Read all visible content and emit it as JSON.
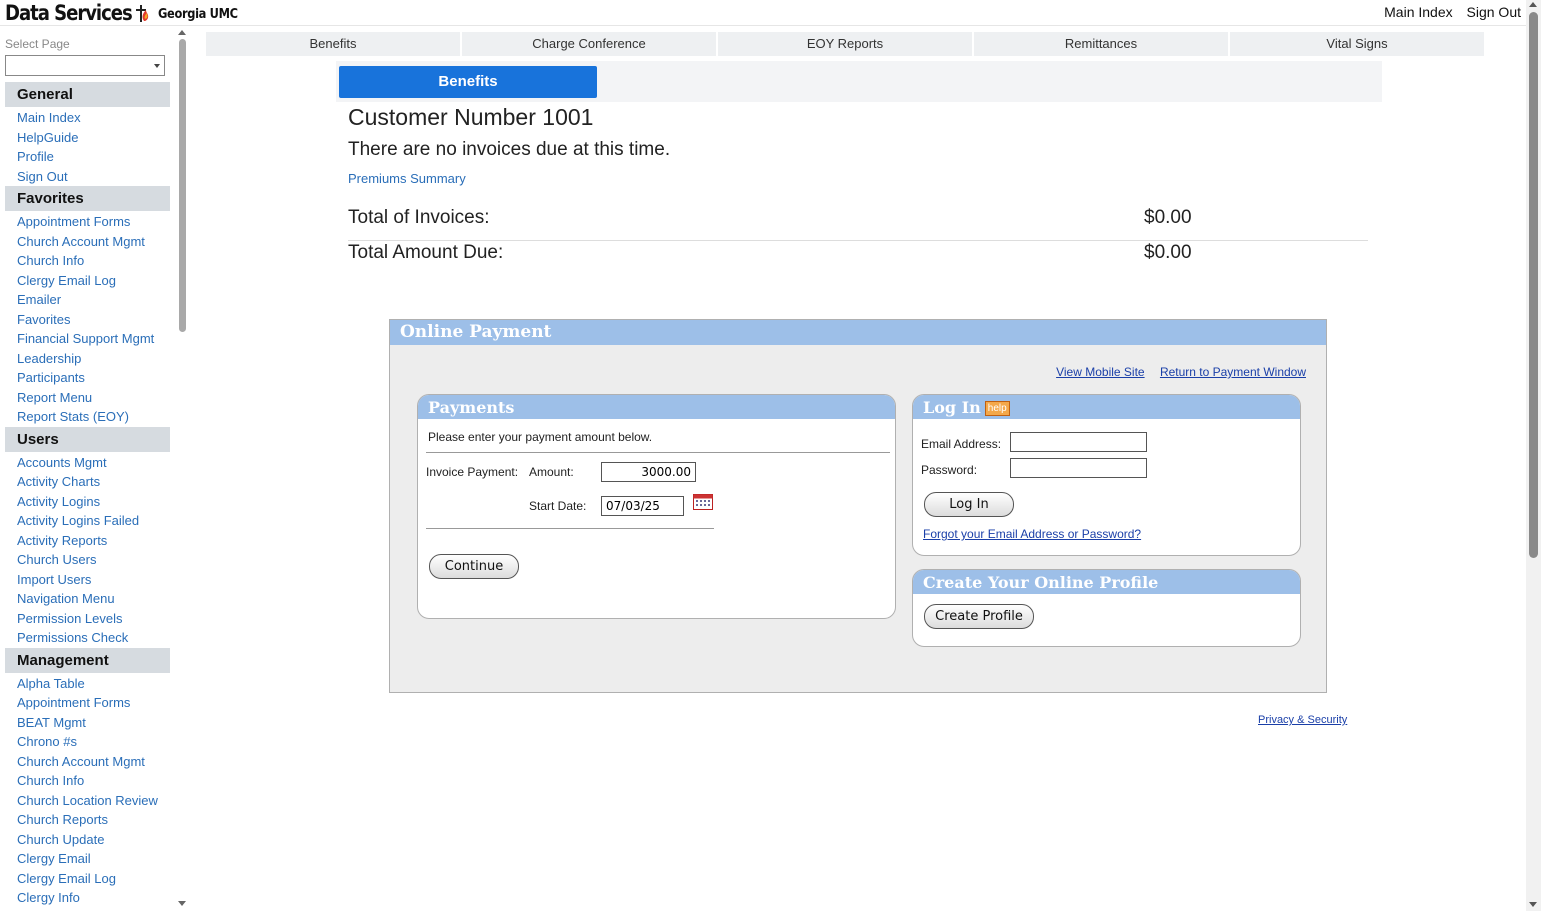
{
  "header": {
    "brand_name": "Data Services",
    "org_name": "Georgia UMC",
    "links": [
      "Main Index",
      "Sign Out"
    ]
  },
  "sidebar": {
    "select_label": "Select Page",
    "select_value": "",
    "sections": [
      {
        "title": "General",
        "items": [
          "Main Index",
          "HelpGuide",
          "Profile",
          "Sign Out"
        ]
      },
      {
        "title": "Favorites",
        "items": [
          "Appointment Forms",
          "Church Account Mgmt",
          "Church Info",
          "Clergy Email Log",
          "Emailer",
          "Favorites",
          "Financial Support Mgmt",
          "Leadership",
          "Participants",
          "Report Menu",
          "Report Stats (EOY)"
        ]
      },
      {
        "title": "Users",
        "items": [
          "Accounts Mgmt",
          "Activity Charts",
          "Activity Logins",
          "Activity Logins Failed",
          "Activity Reports",
          "Church Users",
          "Import Users",
          "Navigation Menu",
          "Permission Levels",
          "Permissions Check"
        ]
      },
      {
        "title": "Management",
        "items": [
          "Alpha Table",
          "Appointment Forms",
          "BEAT Mgmt",
          "Chrono #s",
          "Church Account Mgmt",
          "Church Info",
          "Church Location Review",
          "Church Reports",
          "Church Update",
          "Clergy Email",
          "Clergy Email Log",
          "Clergy Info"
        ]
      }
    ]
  },
  "tabs": [
    "Benefits",
    "Charge Conference",
    "EOY Reports",
    "Remittances",
    "Vital Signs"
  ],
  "section_tab": "Benefits",
  "customer": {
    "title": "Customer Number 1001",
    "message": "There are no invoices due at this time.",
    "premiums_link": "Premiums Summary",
    "total_invoices_label": "Total of Invoices:",
    "total_invoices_value": "$0.00",
    "total_due_label": "Total Amount Due:",
    "total_due_value": "$0.00"
  },
  "online_payment": {
    "title": "Online Payment",
    "links": [
      "View Mobile Site",
      "Return to Payment Window"
    ],
    "payments": {
      "title": "Payments",
      "intro": "Please enter your payment amount below.",
      "invoice_label": "Invoice Payment:",
      "amount_label": "Amount:",
      "amount_value": "3000.00",
      "start_date_label": "Start Date:",
      "start_date_value": "07/03/25",
      "continue_button": "Continue"
    },
    "login": {
      "title": "Log In",
      "help_badge": "help",
      "email_label": "Email Address:",
      "email_value": "",
      "password_label": "Password:",
      "password_value": "",
      "login_button": "Log In",
      "forgot_link": "Forgot your Email Address or Password?"
    },
    "profile": {
      "title": "Create Your Online Profile",
      "create_button": "Create Profile"
    }
  },
  "footer": {
    "privacy_link": "Privacy & Security"
  }
}
